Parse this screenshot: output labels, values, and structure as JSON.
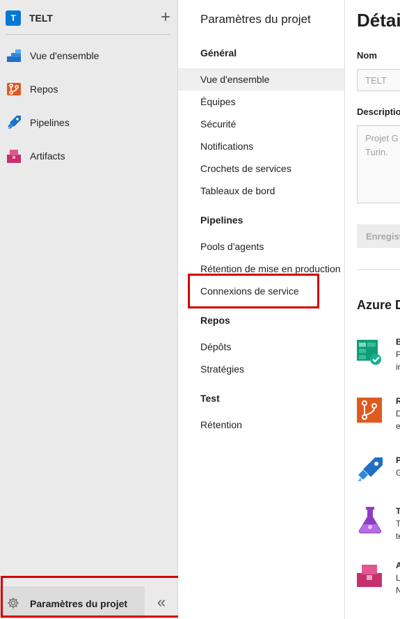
{
  "project": {
    "badge": "T",
    "name": "TELT",
    "add_label": "+"
  },
  "nav": {
    "items": [
      {
        "label": "Vue d'ensemble",
        "icon": "overview-icon"
      },
      {
        "label": "Repos",
        "icon": "repos-icon"
      },
      {
        "label": "Pipelines",
        "icon": "pipelines-icon"
      },
      {
        "label": "Artifacts",
        "icon": "artifacts-icon"
      }
    ],
    "settings_label": "Paramètres du projet",
    "collapse_label": "«"
  },
  "settings_nav": {
    "title": "Paramètres du projet",
    "groups": [
      {
        "heading": "Général",
        "items": [
          "Vue d'ensemble",
          "Équipes",
          "Sécurité",
          "Notifications",
          "Crochets de services",
          "Tableaux de bord"
        ]
      },
      {
        "heading": "Pipelines",
        "items": [
          "Pools d'agents",
          "Rétention de mise en production",
          "Connexions de service"
        ]
      },
      {
        "heading": "Repos",
        "items": [
          "Dépôts",
          "Stratégies"
        ]
      },
      {
        "heading": "Test",
        "items": [
          "Rétention"
        ]
      }
    ],
    "selected": "Vue d'ensemble"
  },
  "content": {
    "title": "Détails du projet",
    "name_label": "Nom",
    "name_value": "TELT",
    "description_label": "Description",
    "description_placeholder": "Projet G\nTurin.",
    "save_label": "Enregistrer",
    "section_title": "Azure DevOps Services",
    "services": [
      {
        "title": "B",
        "line1": "P",
        "line2": "ir",
        "icon": "boards-icon"
      },
      {
        "title": "R",
        "line1": "D",
        "line2": "e",
        "icon": "repos-icon"
      },
      {
        "title": "P",
        "line1": "G",
        "line2": "",
        "icon": "pipelines-icon"
      },
      {
        "title": "T",
        "line1": "T",
        "line2": "te",
        "icon": "test-plans-icon"
      },
      {
        "title": "A",
        "line1": "L",
        "line2": "N",
        "icon": "artifacts-icon"
      }
    ]
  },
  "colors": {
    "highlight_red": "#d30000",
    "brand_blue": "#0078d4"
  }
}
